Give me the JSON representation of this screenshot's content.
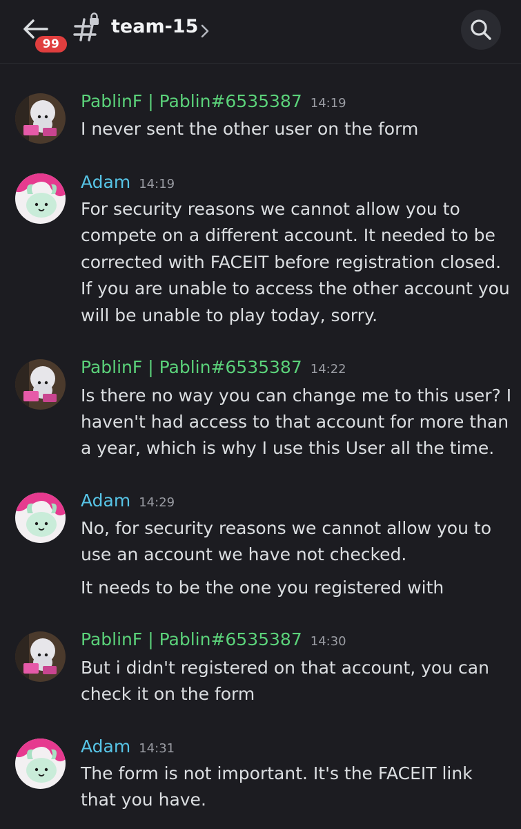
{
  "header": {
    "unread_count": "99",
    "channel_name": "team-15"
  },
  "messages": [
    {
      "author": "PablinF | Pablin#6535387",
      "time": "14:19",
      "lines": [
        "I never sent the other user on the form"
      ]
    },
    {
      "author": "Adam",
      "time": "14:19",
      "lines": [
        "For security reasons we cannot allow you to",
        "compete on a different account. It needed to be",
        "corrected with FACEIT before registration closed.",
        "If you are unable to access the other account you",
        "will be unable to play today, sorry."
      ]
    },
    {
      "author": "PablinF | Pablin#6535387",
      "time": "14:22",
      "lines": [
        "Is there no way you can change me to this user? I",
        "haven't had access to that account for more than",
        "a year, which is why I use this User all the time."
      ]
    },
    {
      "author": "Adam",
      "time": "14:29",
      "lines": [
        "No, for security reasons we cannot allow you to",
        "use an account we have not checked.",
        "It needs to be the one you registered with"
      ]
    },
    {
      "author": "PablinF | Pablin#6535387",
      "time": "14:30",
      "lines": [
        "But i didn't registered on that account, you can",
        "check it on the form"
      ]
    },
    {
      "author": "Adam",
      "time": "14:31",
      "lines": [
        "The form is not important. It's the FACEIT link",
        "that you have."
      ]
    }
  ],
  "colors": {
    "background": "#1c1c21",
    "pablin_name": "#5bd27a",
    "adam_name": "#57c4e6",
    "badge": "#e03e3e"
  },
  "icons": {
    "back": "arrow-left-icon",
    "channel": "locked-hashtag-icon",
    "chevron": "chevron-right-icon",
    "search": "search-icon"
  }
}
